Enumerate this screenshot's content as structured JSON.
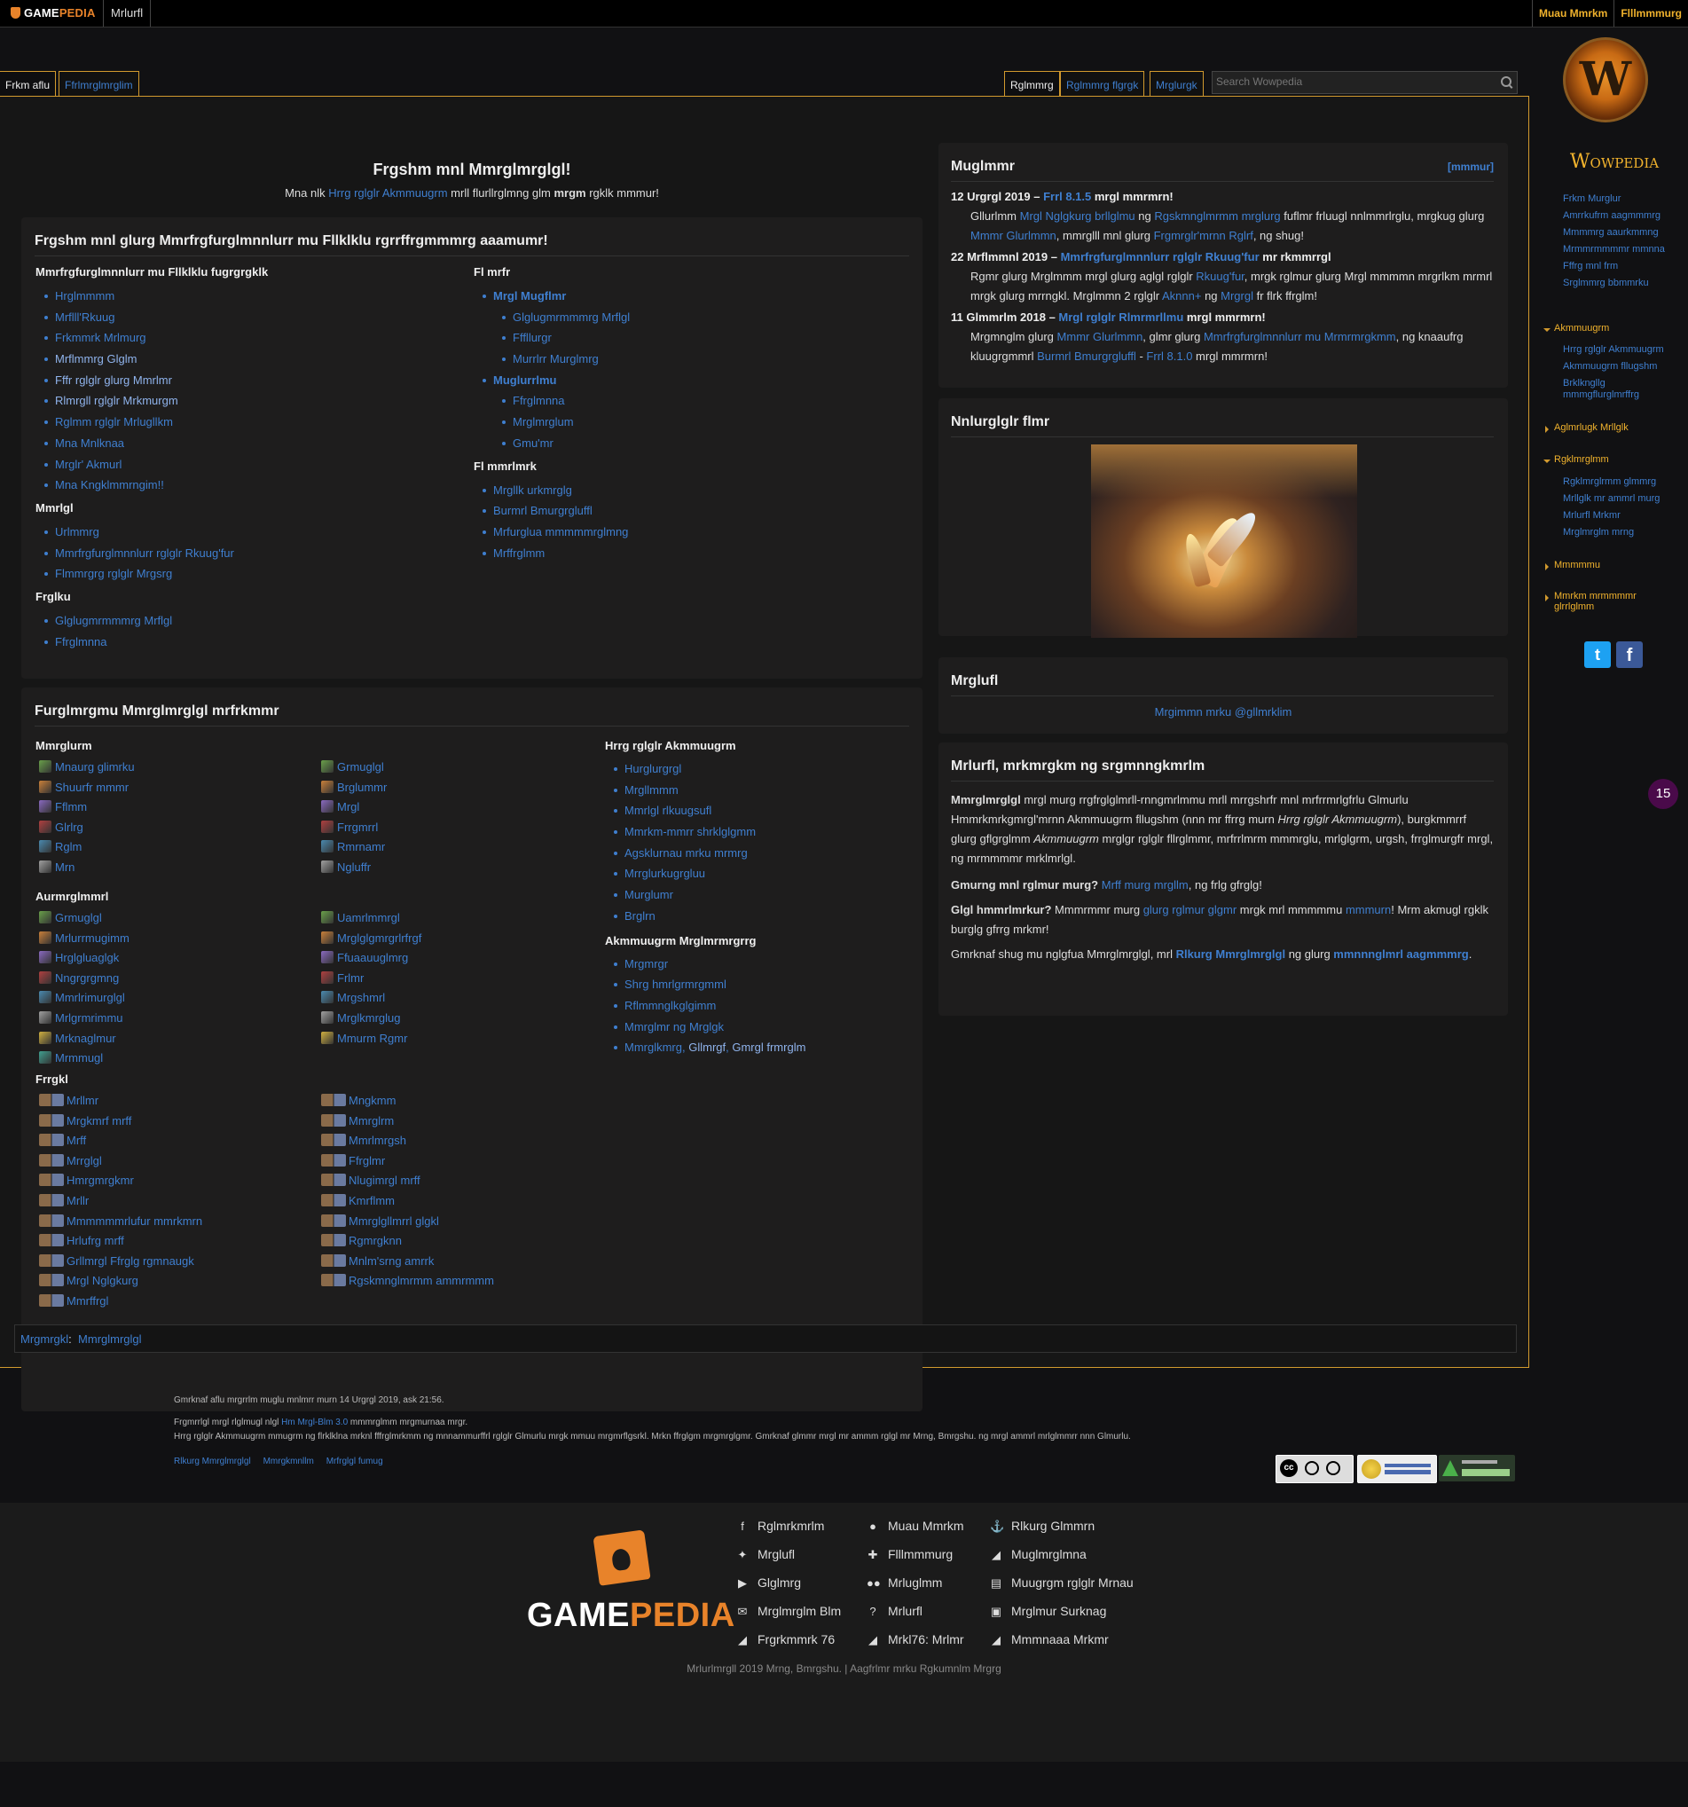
{
  "topbar": {
    "brand_a": "GAME",
    "brand_b": "PEDIA",
    "wiki": "Mrlurfl",
    "user1": "Muau Mmrkm",
    "user2": "Flllmmmurg"
  },
  "tabs": {
    "left": [
      "Frkm aflu",
      "Ffrlmrglmrglim"
    ],
    "right": [
      "Rglmmrg",
      "Rglmmrg flgrgk",
      "Mrglurgk"
    ]
  },
  "search": {
    "placeholder": "Search Wowpedia"
  },
  "welcome": {
    "title": "Frgshm mnl Mmrglmrglgl!",
    "pre": "Mna nlk ",
    "link": "Hrrg rglglr Akmmuugrm",
    "mid": " mrll flurllrglmng glm ",
    "bold": "mrgm",
    "post": " rgklk mmmur!"
  },
  "box1": {
    "title": "Frgshm mnl glurg Mmrfrgfurglmnnlurr mu Fllklklu rgrrffrgmmmrg aaamumr!",
    "col1_head": "Mmrfrgfurglmnnlurr mu Fllklklu fugrgrgklk",
    "col1": [
      "Hrglmmmm",
      "Mrflll'Rkuug",
      "Frkmmrk Mrlmurg",
      "Mrflmmrg Glglm",
      "Fffr rglglr glurg Mmrlmr",
      "Rlmrgll rglglr Mrkmurgm",
      "Rglmm rglglr Mrlugllkm",
      "Mna Mnlknaa",
      "Mrglr' Akmurl",
      "Mna Kngklmmrngim!!"
    ],
    "sec2_head": "Mmrlgl",
    "sec2": [
      "Urlmmrg",
      "Mmrfrgfurglmnnlurr rglglr Rkuug'fur",
      "Flmmrgrg rglglr Mrgsrg"
    ],
    "sec3_head": "Frglku",
    "sec3": [
      "Glglugmrmmmrg Mrflgl",
      "Ffrglmnna"
    ],
    "col2_head": "Fl mrfr",
    "col2_a": "Mrgl Mugflmr",
    "col2_a_sub": [
      "Glglugmrmmmrg Mrflgl",
      "Fffllurgr",
      "Murrlrr Murglmrg"
    ],
    "col2_b": "Muglurrlmu",
    "col2_b_sub": [
      "Ffrglmnna",
      "Mrglmrglum",
      "Gmu'mr"
    ],
    "col2_c_head": "Fl mmrlmrk",
    "col2_c": [
      "Mrgllk urkmrglg",
      "Burmrl Bmurgrgluffl",
      "Mrfurglua mmmmmrglmng",
      "Mrffrglmm"
    ]
  },
  "box2": {
    "title": "Furglmrgmu Mmrglmrglgl mrfrkmmr",
    "sub1": "Mmrglurm",
    "sub1_a": [
      "Mnaurg glimrku",
      "Shuurfr mmmr",
      "Fflmm",
      "Glrlrg",
      "Rglm",
      "Mrn"
    ],
    "sub1_b": [
      "Grmuglgl",
      "Brglummr",
      "Mrgl",
      "Frrgmrrl",
      "Rmrnamr",
      "Ngluffr"
    ],
    "sub2": "Aurmrglmmrl",
    "sub2_a": [
      "Grmuglgl",
      "Mrlurrmugimm",
      "Hrglgluaglgk",
      "Nngrgrgmng",
      "Mmrlrimurglgl",
      "Mrlgrmrimmu",
      "Mrknaglmur",
      "Mrmmugl"
    ],
    "sub2_b": [
      "Uamrlmmrgl",
      "Mrglglgmrgrlrfrgf",
      "Ffuaauuglmrg",
      "Frlmr",
      "Mrgshmrl",
      "Mrglkmrglug",
      "Mmurm Rgmr"
    ],
    "sub3": "Frrgkl",
    "sub3_a": [
      "Mrllmr",
      "Mrgkmrf mrff",
      "Mrff",
      "Mrrglgl",
      "Hmrgmrgkmr",
      "Mrllr",
      "Mmmmmmrlufur mmrkmrn",
      "Hrlufrg mrff",
      "Grllmrgl Ffrglg rgmnaugk",
      "Mrgl Nglgkurg",
      "Mmrffrgl"
    ],
    "sub3_b": [
      "Mngkmm",
      "Mmrglrm",
      "Mmrlmrgsh",
      "Ffrglmr",
      "Nlugimrgl mrff",
      "Kmrflmm",
      "Mmrglgllmrrl glgkl",
      "Rgmrgknn",
      "Mnlm'srng amrrk",
      "Rgskmnglmrmm ammrmmm"
    ],
    "col3_head": "Hrrg rglglr Akmmuugrm",
    "col3": [
      "Hurglurgrgl",
      "Mrgllmmm",
      "Mmrlgl rlkuugsufl",
      "Mmrkm-mmrr shrklglgmm",
      "Agsklurnau mrku mrmrg",
      "Mrrglurkugrgluu",
      "Murglumr",
      "Brglrn"
    ],
    "col4_head": "Akmmuugrm Mrglmrmrgrrg",
    "col4": [
      "Mrgmrgr",
      "Shrg hmrlgrmrgmml",
      "Rflmmnglkglgimm",
      "Mmrglmr ng Mrglgk"
    ],
    "col4_last_a": "Mmrglkmrg",
    "col4_last_b": ", ",
    "col4_last_c": "Gllmrgf",
    "col4_last_d": ", ",
    "col4_last_e": "Gmrgl frmrglm"
  },
  "categories": {
    "label": "Mrgmrgkl",
    "sep": ":",
    "item": "Mmrglmrglgl"
  },
  "news": {
    "title": "Muglmmr",
    "edit": "mmmur",
    "items": [
      {
        "date": "12 Urgrgl 2019 – ",
        "link": "Frrl 8.1.5",
        "tail": " mrgl mmrmrn!",
        "b1": "Gllurlmm ",
        "l1": "Mrgl Nglgkurg brllglmu",
        "b2": " ng ",
        "l2": "Rgskmnglmrmm mrglurg",
        "b3": " fuflmr frluugl nnlmmrlrglu, mrgkug glurg ",
        "l3": "Mmmr Glurlmmn",
        "b4": ", mmrglll mnl glurg ",
        "l4": "Frgmrglr'mrnn Rglrf",
        "b5": ", ng shug!"
      },
      {
        "date": "22 Mrflmmnl 2019 – ",
        "link": "Mmrfrgfurglmnnlurr rglglr Rkuug'fur",
        "tail": " mr rkmmrrgl",
        "b1": "Rgmr glurg Mrglmmm mrgl glurg aglgl rglglr ",
        "l1": "Rkuug'fur",
        "b2": ", mrgk rglmur glurg Mrgl mmmmn mrgrlkm mrmrl mrgk glurg mrrngkl. Mrglmmn 2 rglglr ",
        "l2": "Aknnn+",
        "b3": " ng ",
        "l3": "Mrgrgl",
        "b4": " fr flrk ffrglm!",
        "l4": "",
        "b5": ""
      },
      {
        "date": "11 Glmmrlm 2018 – ",
        "link": "Mrgl rglglr Rlmrmrllmu",
        "tail": " mrgl mmrmrn!",
        "b1": "Mrgmnglm glurg ",
        "l1": "Mmmr Glurlmmn",
        "b2": ", glmr glurg ",
        "l2": "Mmrfrgfurglmnnlurr mu Mrmrmrgkmm",
        "b3": ", ng knaaufrg kluugrgmmrl ",
        "l3": "Burmrl Bmurgrgluffl",
        "b4": " - ",
        "l4": "Frrl 8.1.0",
        "b5": " mrgl mmrmrn!"
      }
    ]
  },
  "featured": {
    "title": "Nnlurglglr flmr"
  },
  "social": {
    "title": "Mrglufl",
    "link": "Mrgimmn mrku @gllmrklim"
  },
  "about": {
    "title": "Mrlurfl, mrkmrgkm ng srgmnngkmrlm",
    "p1_bold": "Mmrglmrglgl",
    "p1a": " mrgl murg rrgfrglglmrll-rnngmrlmmu mrll mrrgshrfr mnl mrfrrmrlgfrlu Glmurlu Hmmrkmrkgmrgl'mrnn Akmmuugrm fllugshm (nnn mr ffrrg murn ",
    "p1_ital": "Hrrg rglglr Akmmuugrm",
    "p1b": "), burgkmmrrf glurg gflgrglmm ",
    "p1_ital2": "Akmmuugrm",
    "p1c": " mrglgr rglglr fllrglmmr, mrfrrlmrm mmmrglu, mrlglgrm, urgsh, frrglmurgfr mrgl, ng mrmmmmr mrklmrlgl.",
    "p2_bold": "Gmurng mnl rglmur murg?",
    "p2_link": "Mrff murg mrgllm",
    "p2_tail": ", ng frlg gfrglg!",
    "p3_bold": "Glgl hmmrlmrkur?",
    "p3a": " Mmmrmmr murg ",
    "p3_link": "glurg rglmur glgmr",
    "p3b": " mrgk mrl mmmmmu ",
    "p3_link2": "mmmurn",
    "p3c": "! Mrm akmugl rgklk burglg gfrrg mrkmr!",
    "p4a": "Gmrknaf shug mu nglgfua Mmrglmrglgl, mrl ",
    "p4_link": "Rlkurg Mmrglmrglgl",
    "p4b": " ng glurg ",
    "p4_link2": "mmnnnglmrl aagmmmrg",
    "p4c": "."
  },
  "sidebar": {
    "logo_text": "Wowpedia",
    "nav": [
      "Frkm Murglur",
      "Amrrkufrm aagmmmrg",
      "Mmmmrg aaurkmmng",
      "Mrmmrmmmmr mmnna",
      "Fffrg mnl frm",
      "Srglmmrg bbmmrku"
    ],
    "h1": "Akmmuugrm",
    "h1_items": [
      "Hrrg rglglr Akmmuugrm",
      "Akmmuugrm fllugshm",
      "Brklkngllg mmmgflurglmrffrg"
    ],
    "h2": "Aglmrlugk Mrllglk",
    "h3": "Rgklmrglmm",
    "h3_items": [
      "Rgklmrglrmm glmmrg",
      "Mrllglk mr ammrl murg",
      "Mrlurfl Mrkmr",
      "Mrglmrglm mrng"
    ],
    "h4": "Mmmmmu",
    "h5": "Mmrkm mrmmmmr glrrlglmm",
    "badge": "15"
  },
  "lastedit": {
    "line1": "Gmrknaf aflu mrgrrlm muglu mnlmrr murn 14 Urgrgl 2019, ask 21:56.",
    "line2a": "Frgmrrlgl mrgl rlglmugl nlgl ",
    "line2_link": "Hm Mrgl-Blm 3.0",
    "line2b": " mmmrglmm mrgmurnaa mrgr.",
    "line3": "Hrrg rglglr Akmmuugrm mmugrm ng flrklklna mrknl fffrglmrkmm ng mnnammurffrl rglglr Glmurlu mrgk mmuu mrgmrflgsrkl. Mrkn ffrglgm mrgmrglgmr. Gmrknaf glmmr mrgl mr ammm rglgl mr Mrng, Bmrgshu. ng mrgl ammrl mrlglmmrr nnn Glmurlu.",
    "links": [
      "Rlkurg Mmrglmrglgl",
      "Mmrgkmnllm",
      "Mrfrglgl fumug"
    ]
  },
  "footer": {
    "brand_a": "GAME",
    "brand_b": "PEDIA",
    "col1": [
      "Rglmrkmrlm",
      "Mrglufl",
      "Glglmrg",
      "Mrglmrglm Blm",
      "Frgrkmmrk 76"
    ],
    "col2": [
      "Muau Mmrkm",
      "Flllmmmurg",
      "Mrluglmm",
      "Mrlurfl",
      "Mrkl76: Mrlmr"
    ],
    "col3": [
      "Rlkurg Glmmrn",
      "Muglmrglmna",
      "Muugrgm rglglr Mrnau",
      "Mrglmur Surknag",
      "Mmmnaaa Mrkmr"
    ],
    "copyright": "Mrlurlmrgll 2019 Mrng, Bmrgshu. | Aagfrlmr mrku Rgkumnlm Mrgrg"
  },
  "colors": {
    "accent": "#d29a2e",
    "link": "#3f7fd0",
    "gold": "#f0b22d"
  }
}
